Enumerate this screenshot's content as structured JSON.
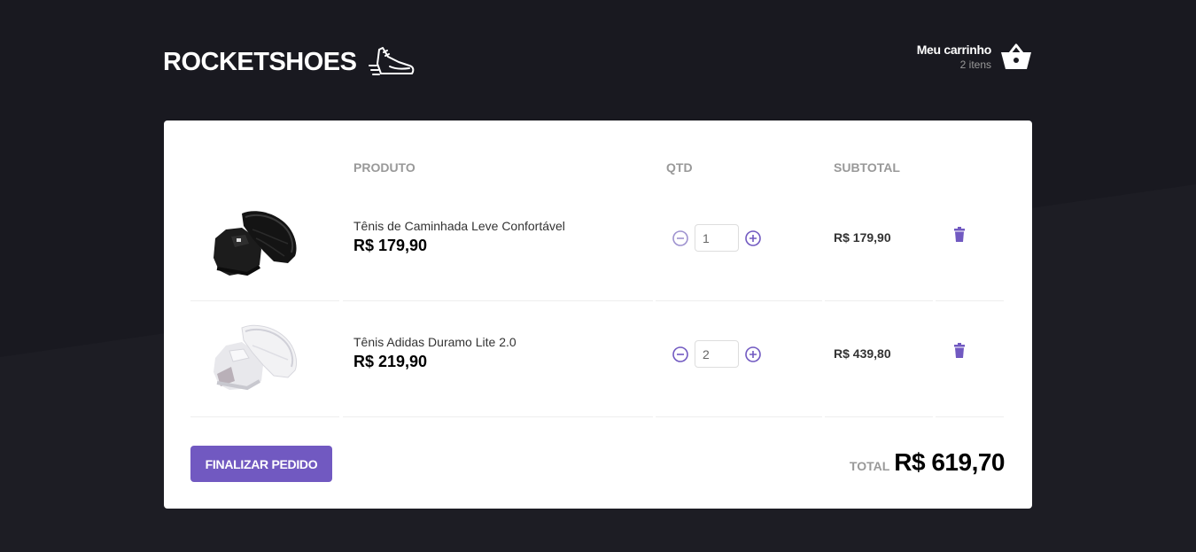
{
  "brand": {
    "name": "ROCKETSHOES",
    "icon": "sneaker-icon"
  },
  "cart_summary": {
    "title": "Meu carrinho",
    "count": "2 itens",
    "icon": "basket-icon"
  },
  "table": {
    "headers": {
      "product": "PRODUTO",
      "qty": "QTD",
      "subtotal": "SUBTOTAL"
    },
    "items": [
      {
        "title": "Tênis de Caminhada Leve Confortável",
        "price": "R$ 179,90",
        "quantity": "1",
        "subtotal": "R$ 179,90",
        "image": "black-sneaker",
        "decrement_enabled": false
      },
      {
        "title": "Tênis Adidas Duramo Lite 2.0",
        "price": "R$ 219,90",
        "quantity": "2",
        "subtotal": "R$ 439,80",
        "image": "white-sneaker",
        "decrement_enabled": true
      }
    ]
  },
  "footer": {
    "button_label": "FINALIZAR PEDIDO",
    "total_label": "TOTAL",
    "total_value": "R$ 619,70"
  },
  "colors": {
    "background": "#191920",
    "accent": "#7159c1",
    "panel": "#ffffff",
    "disabled": "#9e92cf"
  }
}
